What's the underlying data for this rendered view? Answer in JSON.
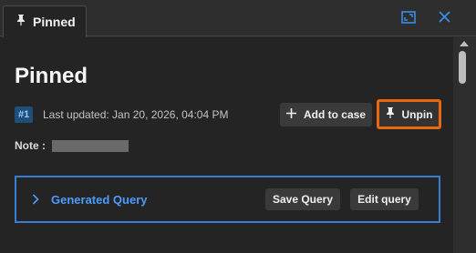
{
  "tab": {
    "label": "Pinned",
    "icon": "pin-icon"
  },
  "window": {
    "expand_icon": "expand-icon",
    "close_icon": "close-icon",
    "accent": "#3a8ee6"
  },
  "main": {
    "title": "Pinned",
    "badge": "#1",
    "last_updated": "Last updated: Jan 20, 2026, 04:04 PM",
    "add_to_case_label": "Add to case",
    "unpin_label": "Unpin",
    "note_label": "Note :",
    "highlight_color": "#e8670f"
  },
  "query": {
    "title": "Generated Query",
    "save_label": "Save Query",
    "edit_label": "Edit query",
    "border_color": "#3a7bd5"
  }
}
